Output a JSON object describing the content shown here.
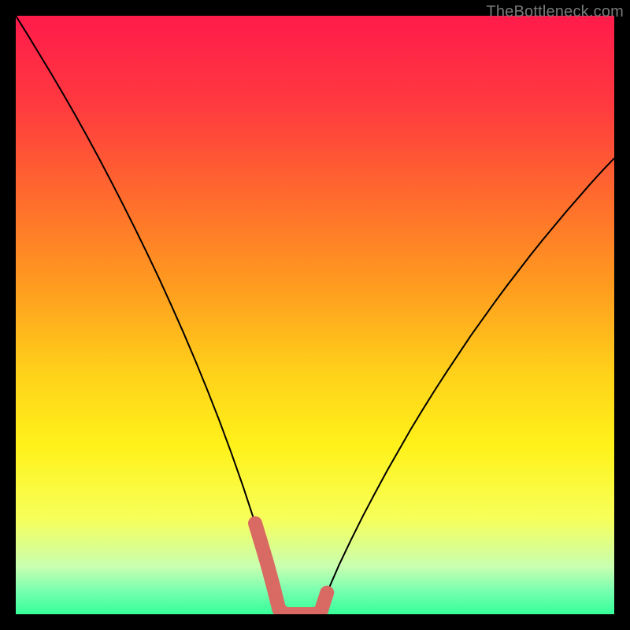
{
  "watermark": {
    "text": "TheBottleneck.com"
  },
  "chart_data": {
    "type": "line",
    "title": "",
    "xlabel": "",
    "ylabel": "",
    "xlim": [
      0,
      100
    ],
    "ylim": [
      0,
      100
    ],
    "series": [
      {
        "name": "bottleneck-curve",
        "x": [
          0,
          2,
          4,
          6,
          8,
          10,
          12,
          14,
          16,
          18,
          20,
          22,
          24,
          26,
          28,
          30,
          32,
          34,
          36,
          38,
          40,
          41,
          42,
          43,
          44,
          45,
          46,
          47,
          48,
          49,
          50,
          51,
          52,
          54,
          56,
          58,
          60,
          62,
          64,
          66,
          68,
          70,
          72,
          74,
          76,
          78,
          80,
          82,
          84,
          86,
          88,
          90,
          92,
          94,
          96,
          98,
          100
        ],
        "y": [
          100,
          96.8,
          93.5,
          90.2,
          86.8,
          83.3,
          79.7,
          76.0,
          72.2,
          68.3,
          64.3,
          60.2,
          56.0,
          51.6,
          47.1,
          42.4,
          37.5,
          32.4,
          27.0,
          21.3,
          15.2,
          11.9,
          8.5,
          4.8,
          0.8,
          0.0,
          0.0,
          0.0,
          0.0,
          0.0,
          0.0,
          0.5,
          3.6,
          8.2,
          12.4,
          16.4,
          20.2,
          23.9,
          27.4,
          30.9,
          34.2,
          37.4,
          40.5,
          43.5,
          46.5,
          49.3,
          52.1,
          54.8,
          57.4,
          60.0,
          62.5,
          64.9,
          67.3,
          69.6,
          71.9,
          74.1,
          76.2
        ]
      }
    ],
    "highlights": [
      {
        "name": "optimal-region",
        "x": [
          40,
          41,
          42,
          43,
          44,
          45,
          46,
          47,
          48,
          49,
          50,
          51,
          52
        ],
        "y": [
          15.2,
          11.9,
          8.5,
          4.8,
          0.8,
          0.0,
          0.0,
          0.0,
          0.0,
          0.0,
          0.0,
          0.5,
          3.6
        ]
      }
    ],
    "background_gradient": [
      {
        "pos": 0.0,
        "color": "#ff1b4b"
      },
      {
        "pos": 0.15,
        "color": "#ff3a3f"
      },
      {
        "pos": 0.3,
        "color": "#ff6a2e"
      },
      {
        "pos": 0.45,
        "color": "#ff9b1f"
      },
      {
        "pos": 0.6,
        "color": "#ffd21a"
      },
      {
        "pos": 0.72,
        "color": "#fff21a"
      },
      {
        "pos": 0.84,
        "color": "#f7ff5a"
      },
      {
        "pos": 0.92,
        "color": "#c9ffb0"
      },
      {
        "pos": 0.96,
        "color": "#7affb0"
      },
      {
        "pos": 1.0,
        "color": "#35ff9a"
      }
    ],
    "curve_color": "#000000",
    "highlight_color": "#d96a63"
  }
}
